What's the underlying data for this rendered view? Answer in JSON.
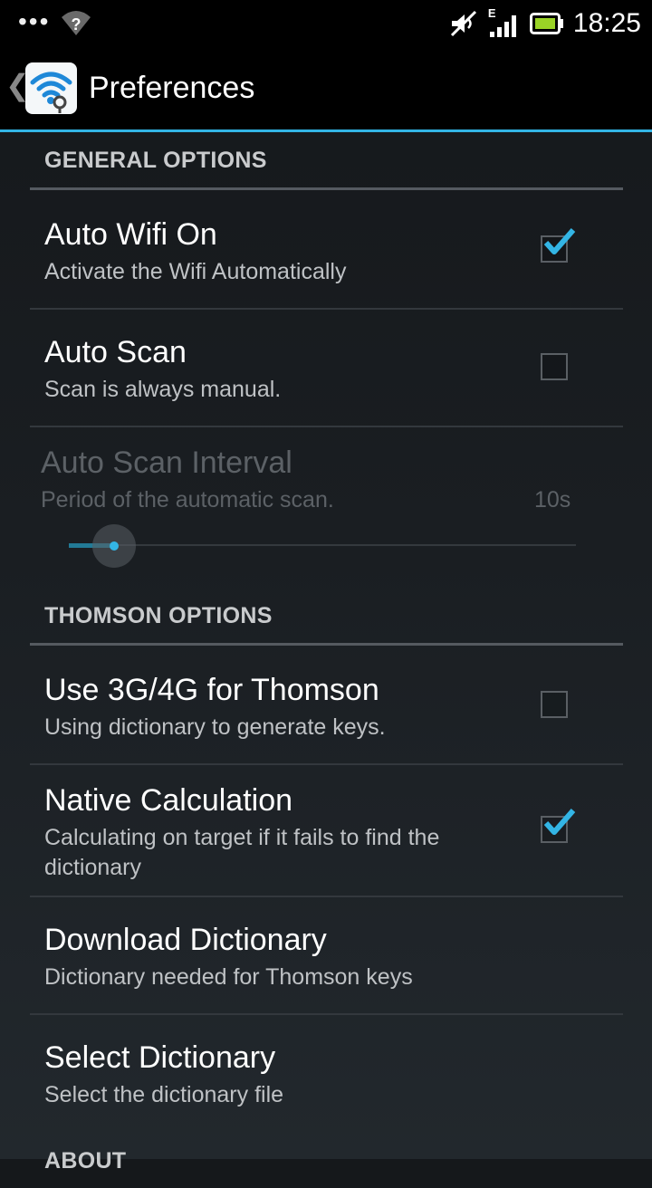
{
  "status_bar": {
    "time": "18:25",
    "network_label": "E",
    "icons": [
      "overflow-dots-icon",
      "wifi-unknown-icon",
      "mute-icon",
      "signal-icon",
      "battery-icon"
    ]
  },
  "action_bar": {
    "title": "Preferences",
    "icon": "wifi-key-app-icon"
  },
  "sections": {
    "general": {
      "title": "GENERAL OPTIONS"
    },
    "thomson": {
      "title": "THOMSON OPTIONS"
    },
    "about": {
      "title": "ABOUT"
    }
  },
  "prefs": {
    "auto_wifi": {
      "title": "Auto Wifi On",
      "summary": "Activate the Wifi Automatically",
      "checked": true
    },
    "auto_scan": {
      "title": "Auto Scan",
      "summary": "Scan is always manual.",
      "checked": false
    },
    "scan_interval": {
      "title": "Auto Scan Interval",
      "summary": "Period of the automatic scan.",
      "value": "10s",
      "enabled": false
    },
    "use_3g": {
      "title": "Use 3G/4G for Thomson",
      "summary": "Using dictionary to generate keys.",
      "checked": false
    },
    "native_calc": {
      "title": "Native Calculation",
      "summary_line1": "Calculating on target if it fails to find the",
      "summary_line2": "dictionary",
      "checked": true
    },
    "download_dict": {
      "title": "Download Dictionary",
      "summary": "Dictionary needed for Thomson keys"
    },
    "select_dict": {
      "title": "Select Dictionary",
      "summary": "Select the dictionary file"
    }
  },
  "colors": {
    "accent": "#33b5e5",
    "background": "#1a1e22"
  }
}
